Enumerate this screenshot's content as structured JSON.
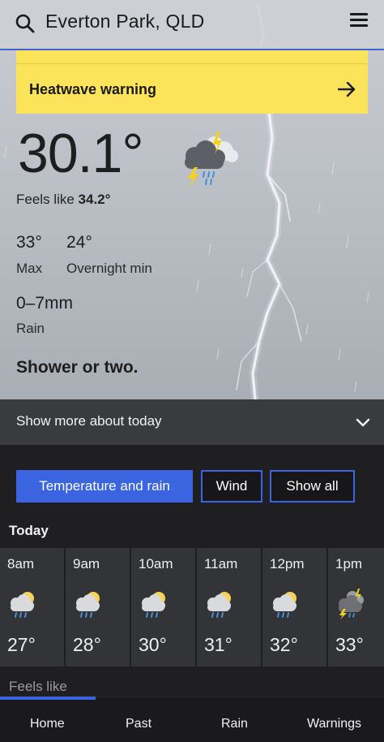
{
  "header": {
    "location": "Everton Park, QLD"
  },
  "warning": {
    "label": "Heatwave warning"
  },
  "current": {
    "temperature": "30.1°",
    "feels_like_label": "Feels like",
    "feels_like_value": "34.2°",
    "max_value": "33°",
    "max_label": "Max",
    "overnight_value": "24°",
    "overnight_label": "Overnight min",
    "rain_value": "0–7mm",
    "rain_label": "Rain",
    "summary": "Shower or two.",
    "icon": "storm-cloud-icon"
  },
  "show_more": {
    "label": "Show more about today"
  },
  "filters": [
    {
      "label": "Temperature and rain",
      "active": true
    },
    {
      "label": "Wind",
      "active": false
    },
    {
      "label": "Show all",
      "active": false
    }
  ],
  "hourly": {
    "day_label": "Today",
    "hours": [
      {
        "time": "8am",
        "temp": "27°",
        "icon": "shower-sun-icon"
      },
      {
        "time": "9am",
        "temp": "28°",
        "icon": "shower-sun-icon"
      },
      {
        "time": "10am",
        "temp": "30°",
        "icon": "shower-sun-icon"
      },
      {
        "time": "11am",
        "temp": "31°",
        "icon": "shower-sun-icon"
      },
      {
        "time": "12pm",
        "temp": "32°",
        "icon": "shower-sun-icon"
      },
      {
        "time": "1pm",
        "temp": "33°",
        "icon": "storm-icon"
      }
    ],
    "feels_like_label": "Feels like"
  },
  "nav": [
    {
      "label": "Home",
      "active": true
    },
    {
      "label": "Past",
      "active": false
    },
    {
      "label": "Rain",
      "active": false
    },
    {
      "label": "Warnings",
      "active": false
    }
  ],
  "colors": {
    "accent": "#3a64e0",
    "warning": "#fbe35a",
    "dark": "#1f1f21"
  }
}
